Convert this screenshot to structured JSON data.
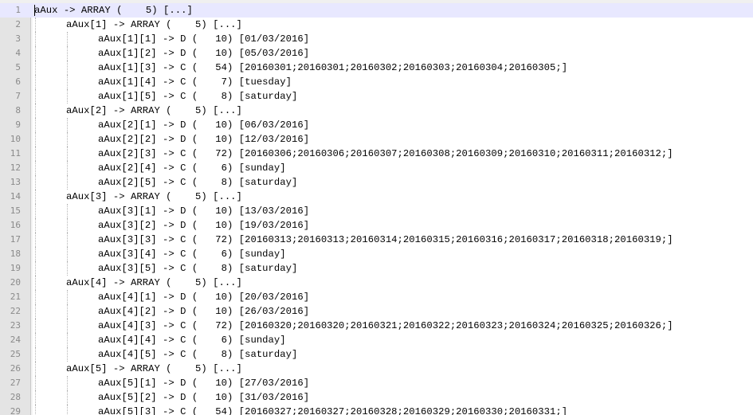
{
  "lines": [
    {
      "num": "1",
      "text": "aAux -> ARRAY (    5) [...]",
      "level": 0
    },
    {
      "num": "2",
      "text": "aAux[1] -> ARRAY (    5) [...]",
      "level": 1
    },
    {
      "num": "3",
      "text": "aAux[1][1] -> D (   10) [01/03/2016]",
      "level": 2
    },
    {
      "num": "4",
      "text": "aAux[1][2] -> D (   10) [05/03/2016]",
      "level": 2
    },
    {
      "num": "5",
      "text": "aAux[1][3] -> C (   54) [20160301;20160301;20160302;20160303;20160304;20160305;]",
      "level": 2
    },
    {
      "num": "6",
      "text": "aAux[1][4] -> C (    7) [tuesday]",
      "level": 2
    },
    {
      "num": "7",
      "text": "aAux[1][5] -> C (    8) [saturday]",
      "level": 2
    },
    {
      "num": "8",
      "text": "aAux[2] -> ARRAY (    5) [...]",
      "level": 1
    },
    {
      "num": "9",
      "text": "aAux[2][1] -> D (   10) [06/03/2016]",
      "level": 2
    },
    {
      "num": "10",
      "text": "aAux[2][2] -> D (   10) [12/03/2016]",
      "level": 2
    },
    {
      "num": "11",
      "text": "aAux[2][3] -> C (   72) [20160306;20160306;20160307;20160308;20160309;20160310;20160311;20160312;]",
      "level": 2
    },
    {
      "num": "12",
      "text": "aAux[2][4] -> C (    6) [sunday]",
      "level": 2
    },
    {
      "num": "13",
      "text": "aAux[2][5] -> C (    8) [saturday]",
      "level": 2
    },
    {
      "num": "14",
      "text": "aAux[3] -> ARRAY (    5) [...]",
      "level": 1
    },
    {
      "num": "15",
      "text": "aAux[3][1] -> D (   10) [13/03/2016]",
      "level": 2
    },
    {
      "num": "16",
      "text": "aAux[3][2] -> D (   10) [19/03/2016]",
      "level": 2
    },
    {
      "num": "17",
      "text": "aAux[3][3] -> C (   72) [20160313;20160313;20160314;20160315;20160316;20160317;20160318;20160319;]",
      "level": 2
    },
    {
      "num": "18",
      "text": "aAux[3][4] -> C (    6) [sunday]",
      "level": 2
    },
    {
      "num": "19",
      "text": "aAux[3][5] -> C (    8) [saturday]",
      "level": 2
    },
    {
      "num": "20",
      "text": "aAux[4] -> ARRAY (    5) [...]",
      "level": 1
    },
    {
      "num": "21",
      "text": "aAux[4][1] -> D (   10) [20/03/2016]",
      "level": 2
    },
    {
      "num": "22",
      "text": "aAux[4][2] -> D (   10) [26/03/2016]",
      "level": 2
    },
    {
      "num": "23",
      "text": "aAux[4][3] -> C (   72) [20160320;20160320;20160321;20160322;20160323;20160324;20160325;20160326;]",
      "level": 2
    },
    {
      "num": "24",
      "text": "aAux[4][4] -> C (    6) [sunday]",
      "level": 2
    },
    {
      "num": "25",
      "text": "aAux[4][5] -> C (    8) [saturday]",
      "level": 2
    },
    {
      "num": "26",
      "text": "aAux[5] -> ARRAY (    5) [...]",
      "level": 1
    },
    {
      "num": "27",
      "text": "aAux[5][1] -> D (   10) [27/03/2016]",
      "level": 2
    },
    {
      "num": "28",
      "text": "aAux[5][2] -> D (   10) [31/03/2016]",
      "level": 2
    },
    {
      "num": "29",
      "text": "aAux[5][3] -> C (   54) [20160327;20160327;20160328;20160329;20160330;20160331;]",
      "level": 2
    }
  ]
}
